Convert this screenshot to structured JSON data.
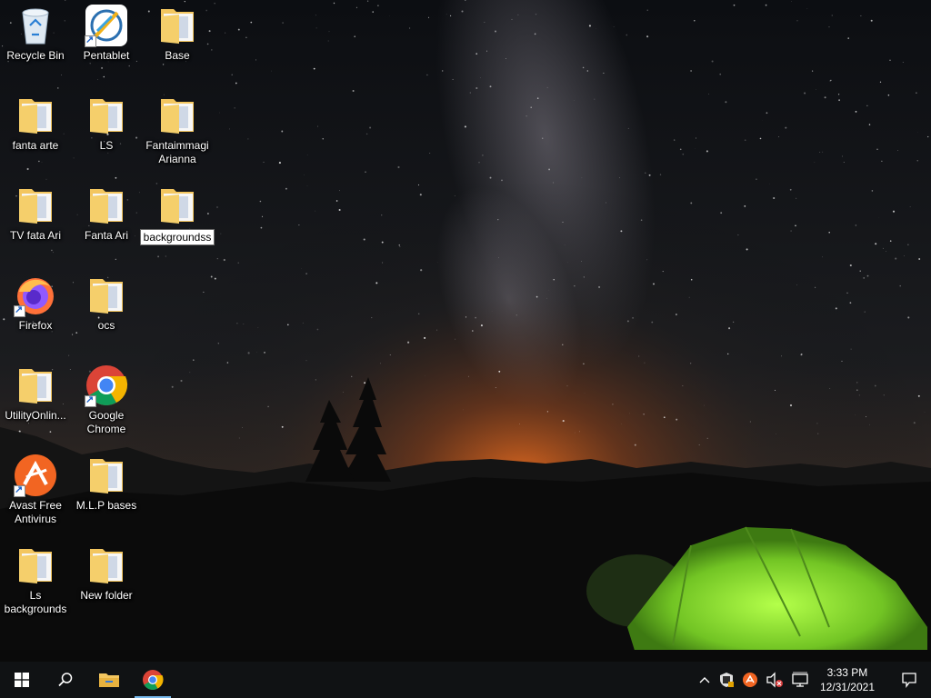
{
  "desktop": {
    "icons": [
      {
        "label": "Recycle Bin",
        "type": "recycle-bin"
      },
      {
        "label": "Pentablet",
        "type": "app-pentablet",
        "shortcut": true
      },
      {
        "label": "Base",
        "type": "folder"
      },
      {
        "label": "fanta arte",
        "type": "folder"
      },
      {
        "label": "LS",
        "type": "folder"
      },
      {
        "label": "Fantaimmagi Arianna",
        "type": "folder"
      },
      {
        "label": "TV  fata Ari",
        "type": "folder"
      },
      {
        "label": "Fanta Ari",
        "type": "folder"
      },
      {
        "label": "backgroundss",
        "type": "folder",
        "renaming": true
      },
      {
        "label": "Firefox",
        "type": "app-firefox",
        "shortcut": true
      },
      {
        "label": "ocs",
        "type": "folder"
      },
      {
        "label": "UtilityOnlin...",
        "type": "folder"
      },
      {
        "label": "Google Chrome",
        "type": "app-chrome",
        "shortcut": true
      },
      {
        "label": "Avast Free Antivirus",
        "type": "app-avast",
        "shortcut": true
      },
      {
        "label": "M.L.P bases",
        "type": "folder"
      },
      {
        "label": "Ls backgrounds",
        "type": "folder"
      },
      {
        "label": "New folder",
        "type": "folder"
      }
    ]
  },
  "taskbar": {
    "start": "windows-logo-icon",
    "search": "search-icon",
    "pinned": [
      {
        "name": "file-explorer-icon"
      },
      {
        "name": "chrome-icon",
        "active": true
      }
    ],
    "tray": {
      "icons": [
        "chevron-up-icon",
        "security-shield-icon",
        "avast-tray-icon",
        "volume-muted-icon",
        "network-icon"
      ],
      "time": "3:33 PM",
      "date": "12/31/2021",
      "notification": "action-center-icon"
    }
  },
  "colors": {
    "taskbar": "#101214",
    "accent": "#76b9ed",
    "folder": "#f3c65f",
    "tent": "#8fe63a",
    "sky_glow": "#d8601b"
  }
}
